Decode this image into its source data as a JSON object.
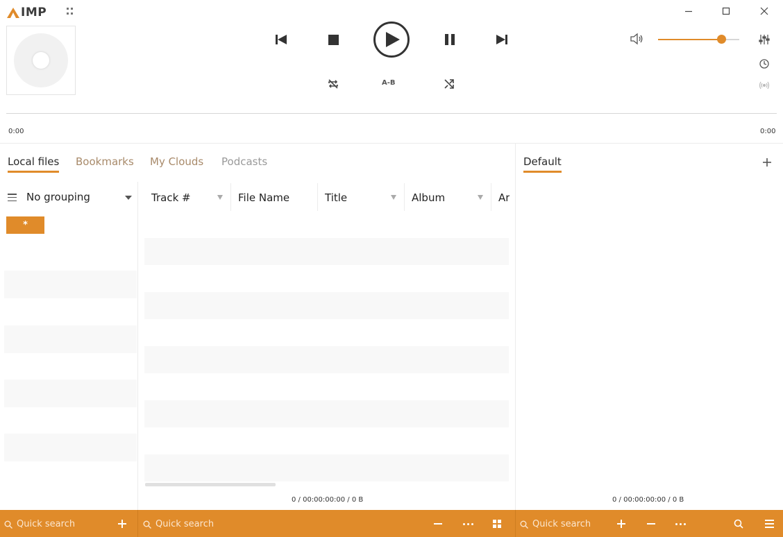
{
  "app": {
    "logo_text": "IMP",
    "accent_color": "#e08b2a"
  },
  "window": {
    "minimize_icon": "minimize-icon",
    "maximize_icon": "maximize-icon",
    "close_icon": "close-icon"
  },
  "player": {
    "ab_label": "A-B",
    "time_elapsed": "0:00",
    "time_total": "0:00",
    "volume_fraction": 0.78
  },
  "library": {
    "tabs": [
      {
        "label": "Local files",
        "active": true
      },
      {
        "label": "Bookmarks"
      },
      {
        "label": "My Clouds"
      },
      {
        "label": "Podcasts"
      }
    ],
    "grouping": {
      "label": "No grouping",
      "chip": "*"
    },
    "columns": [
      "Track #",
      "File Name",
      "Title",
      "Album",
      "Ar"
    ],
    "status": "0 / 00:00:00:00 / 0 B"
  },
  "playlist": {
    "tab": "Default",
    "status": "0 / 00:00:00:00 / 0 B"
  },
  "bottombar": {
    "search_left": "Quick search",
    "search_middle": "Quick search",
    "search_right": "Quick search"
  }
}
